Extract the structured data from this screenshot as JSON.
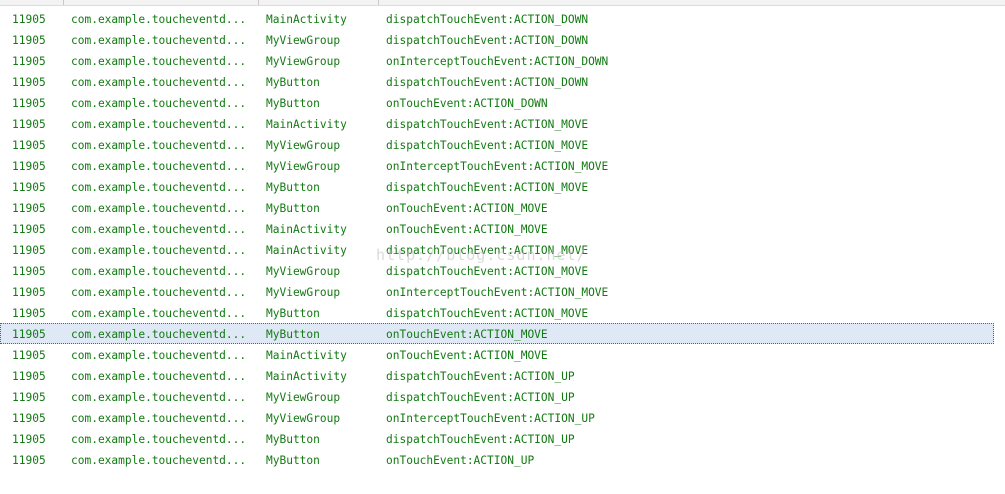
{
  "log": {
    "text_color": "#127a12",
    "selected_row_index": 15,
    "rows": [
      {
        "pid": "11905",
        "application": "com.example.toucheventd...",
        "tag": "MainActivity",
        "text": "dispatchTouchEvent:ACTION_DOWN"
      },
      {
        "pid": "11905",
        "application": "com.example.toucheventd...",
        "tag": "MyViewGroup",
        "text": "dispatchTouchEvent:ACTION_DOWN"
      },
      {
        "pid": "11905",
        "application": "com.example.toucheventd...",
        "tag": "MyViewGroup",
        "text": "onInterceptTouchEvent:ACTION_DOWN"
      },
      {
        "pid": "11905",
        "application": "com.example.toucheventd...",
        "tag": "MyButton",
        "text": "dispatchTouchEvent:ACTION_DOWN"
      },
      {
        "pid": "11905",
        "application": "com.example.toucheventd...",
        "tag": "MyButton",
        "text": "onTouchEvent:ACTION_DOWN"
      },
      {
        "pid": "11905",
        "application": "com.example.toucheventd...",
        "tag": "MainActivity",
        "text": "dispatchTouchEvent:ACTION_MOVE"
      },
      {
        "pid": "11905",
        "application": "com.example.toucheventd...",
        "tag": "MyViewGroup",
        "text": "dispatchTouchEvent:ACTION_MOVE"
      },
      {
        "pid": "11905",
        "application": "com.example.toucheventd...",
        "tag": "MyViewGroup",
        "text": "onInterceptTouchEvent:ACTION_MOVE"
      },
      {
        "pid": "11905",
        "application": "com.example.toucheventd...",
        "tag": "MyButton",
        "text": "dispatchTouchEvent:ACTION_MOVE"
      },
      {
        "pid": "11905",
        "application": "com.example.toucheventd...",
        "tag": "MyButton",
        "text": "onTouchEvent:ACTION_MOVE"
      },
      {
        "pid": "11905",
        "application": "com.example.toucheventd...",
        "tag": "MainActivity",
        "text": "onTouchEvent:ACTION_MOVE"
      },
      {
        "pid": "11905",
        "application": "com.example.toucheventd...",
        "tag": "MainActivity",
        "text": "dispatchTouchEvent:ACTION_MOVE"
      },
      {
        "pid": "11905",
        "application": "com.example.toucheventd...",
        "tag": "MyViewGroup",
        "text": "dispatchTouchEvent:ACTION_MOVE"
      },
      {
        "pid": "11905",
        "application": "com.example.toucheventd...",
        "tag": "MyViewGroup",
        "text": "onInterceptTouchEvent:ACTION_MOVE"
      },
      {
        "pid": "11905",
        "application": "com.example.toucheventd...",
        "tag": "MyButton",
        "text": "dispatchTouchEvent:ACTION_MOVE"
      },
      {
        "pid": "11905",
        "application": "com.example.toucheventd...",
        "tag": "MyButton",
        "text": "onTouchEvent:ACTION_MOVE"
      },
      {
        "pid": "11905",
        "application": "com.example.toucheventd...",
        "tag": "MainActivity",
        "text": "onTouchEvent:ACTION_MOVE"
      },
      {
        "pid": "11905",
        "application": "com.example.toucheventd...",
        "tag": "MainActivity",
        "text": "dispatchTouchEvent:ACTION_UP"
      },
      {
        "pid": "11905",
        "application": "com.example.toucheventd...",
        "tag": "MyViewGroup",
        "text": "dispatchTouchEvent:ACTION_UP"
      },
      {
        "pid": "11905",
        "application": "com.example.toucheventd...",
        "tag": "MyViewGroup",
        "text": "onInterceptTouchEvent:ACTION_UP"
      },
      {
        "pid": "11905",
        "application": "com.example.toucheventd...",
        "tag": "MyButton",
        "text": "dispatchTouchEvent:ACTION_UP"
      },
      {
        "pid": "11905",
        "application": "com.example.toucheventd...",
        "tag": "MyButton",
        "text": "onTouchEvent:ACTION_UP"
      }
    ]
  },
  "watermark": {
    "text": "http://blog.csdn.net/"
  }
}
